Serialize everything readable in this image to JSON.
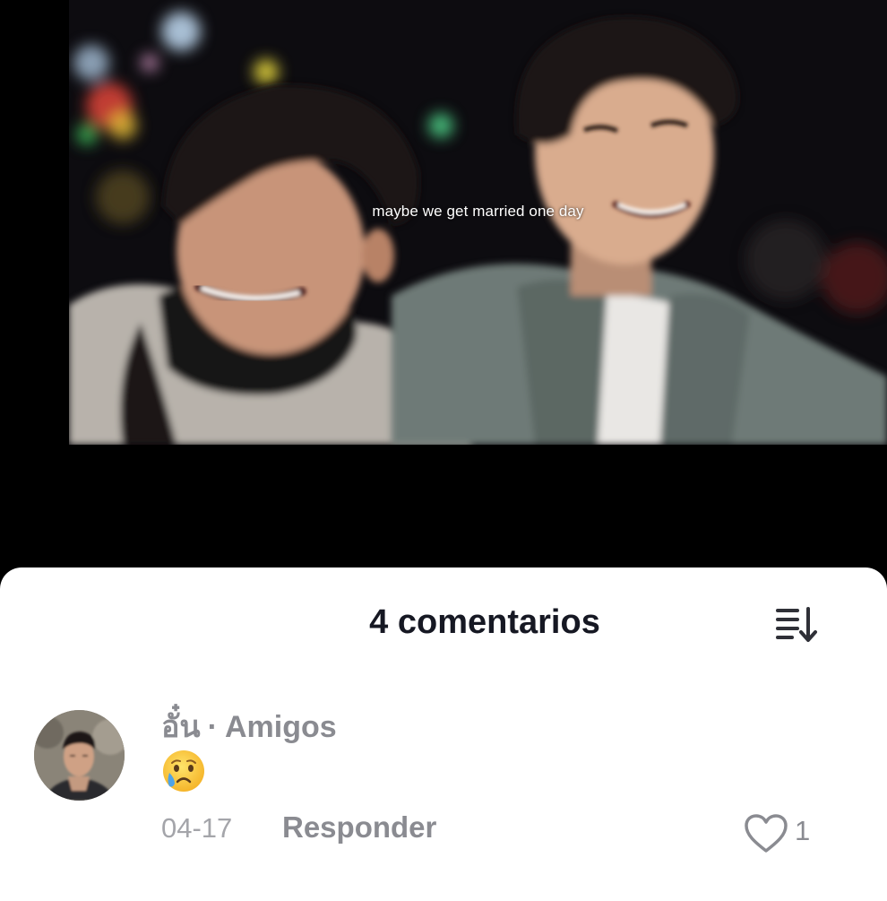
{
  "video": {
    "caption": "maybe we get married one day"
  },
  "comments_sheet": {
    "title": "4 comentarios",
    "sort_icon": "sort-descending-icon",
    "comments": [
      {
        "author": "อั๋น",
        "separator": "·",
        "relation": "Amigos",
        "content_emoji": "crying-face-emoji",
        "date": "04-17",
        "reply_label": "Responder",
        "like_icon": "heart-outline-icon",
        "like_count": "1"
      }
    ]
  },
  "colors": {
    "sheet_background": "#ffffff",
    "title_text": "#161823",
    "secondary_text": "#8a8b91",
    "date_text": "#a4a5aa",
    "video_background": "#0a090c"
  }
}
